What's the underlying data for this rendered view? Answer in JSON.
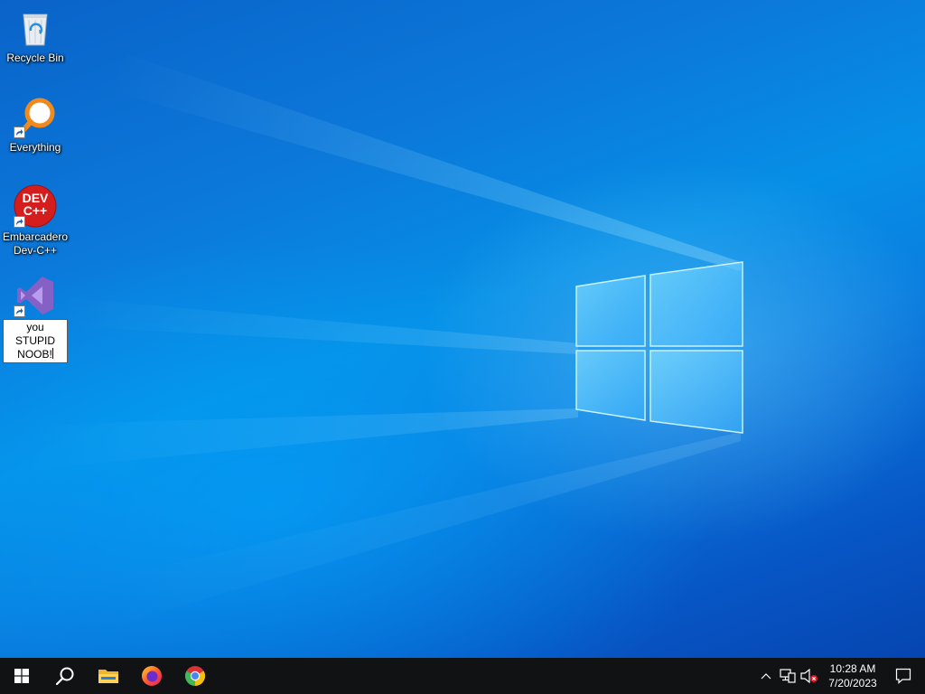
{
  "desktop": {
    "icons": [
      {
        "label": "Recycle Bin",
        "icon": "recycle-bin-icon",
        "shortcut": false
      },
      {
        "label": "Everything",
        "icon": "everything-search-icon",
        "shortcut": true
      },
      {
        "label": "Embarcadero Dev-C++",
        "icon": "dev-cpp-icon",
        "badge_text": "DEV C++",
        "shortcut": true
      },
      {
        "label": "you STUPID NOOB!",
        "icon": "visual-studio-icon",
        "shortcut": true,
        "renaming": true
      }
    ]
  },
  "taskbar": {
    "start_icon": "windows-start-icon",
    "search_icon": "search-icon",
    "pinned": [
      {
        "name": "File Explorer",
        "icon": "file-explorer-icon"
      },
      {
        "name": "Firefox",
        "icon": "firefox-icon"
      },
      {
        "name": "Chrome",
        "icon": "chrome-icon"
      }
    ],
    "tray": {
      "icons": [
        "show-hidden-icons-icon",
        "network-icon",
        "volume-muted-icon"
      ],
      "time": "10:28 AM",
      "date": "7/20/2023",
      "notification_icon": "action-center-icon"
    }
  },
  "colors": {
    "accent_blue": "#0a78da",
    "taskbar": "#101214",
    "everything_orange": "#f08a1c",
    "devcpp_red": "#d41e1e",
    "vs_purple": "#8661c5"
  }
}
